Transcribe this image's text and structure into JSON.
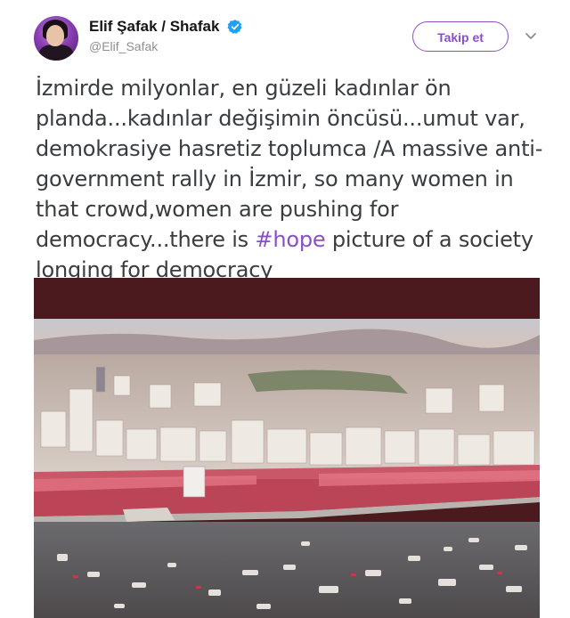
{
  "author": {
    "display_name": "Elif Şafak / Shafak",
    "handle": "@Elif_Safak",
    "verified": true
  },
  "follow_button": {
    "label": "Takip et"
  },
  "tweet": {
    "text_before_hashtag": "İzmirde milyonlar, en güzeli kadınlar ön planda...kadınlar değişimin öncüsü...umut var, demokrasiye hasretiz toplumca /A massive anti-government rally in İzmir, so many women in that crowd,women are pushing for democracy...there is ",
    "hashtag": "#hope",
    "text_after_hashtag": " picture of a society longing for democracy"
  },
  "colors": {
    "accent": "#8a4fc7",
    "verified": "#1da1f2",
    "media_frame": "#4a1a1f"
  },
  "icons": [
    "verified-badge-icon",
    "chevron-down-icon"
  ]
}
